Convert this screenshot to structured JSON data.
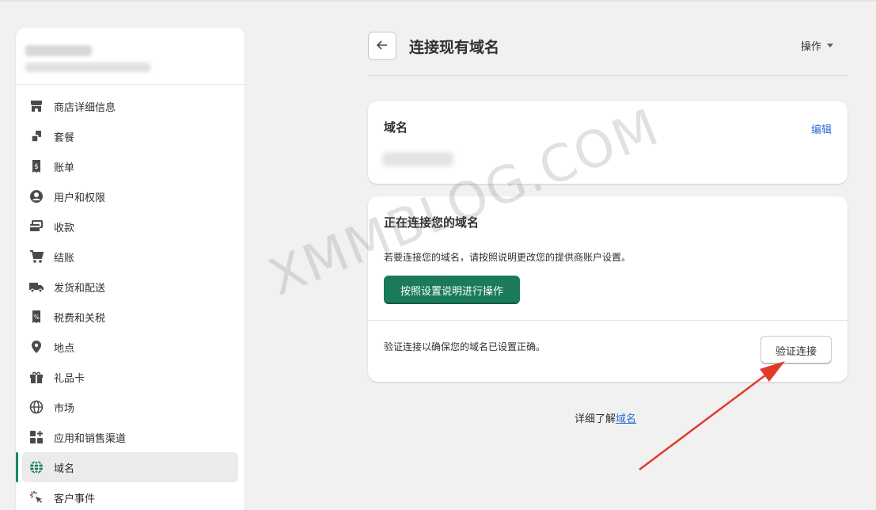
{
  "sidebar": {
    "items": [
      {
        "label": "商店详细信息",
        "icon": "store-icon"
      },
      {
        "label": "套餐",
        "icon": "plan-icon"
      },
      {
        "label": "账单",
        "icon": "billing-icon"
      },
      {
        "label": "用户和权限",
        "icon": "user-icon"
      },
      {
        "label": "收款",
        "icon": "payments-icon"
      },
      {
        "label": "结账",
        "icon": "cart-icon"
      },
      {
        "label": "发货和配送",
        "icon": "truck-icon"
      },
      {
        "label": "税费和关税",
        "icon": "tax-icon"
      },
      {
        "label": "地点",
        "icon": "location-icon"
      },
      {
        "label": "礼品卡",
        "icon": "gift-icon"
      },
      {
        "label": "市场",
        "icon": "globe-icon"
      },
      {
        "label": "应用和销售渠道",
        "icon": "apps-icon"
      },
      {
        "label": "域名",
        "icon": "domain-globe-icon",
        "active": true
      },
      {
        "label": "客户事件",
        "icon": "sparkle-icon"
      }
    ]
  },
  "header": {
    "title": "连接现有域名",
    "actions_label": "操作"
  },
  "domain_card": {
    "title": "域名",
    "edit_label": "编辑"
  },
  "connect_card": {
    "title": "正在连接您的域名",
    "description": "若要连接您的域名，请按照说明更改您的提供商账户设置。",
    "primary_button": "按照设置说明进行操作",
    "verify_text": "验证连接以确保您的域名已设置正确。",
    "verify_button": "验证连接"
  },
  "footer": {
    "prefix": "详细了解",
    "link": "域名"
  },
  "watermark": "XMMBLOG.COM",
  "colors": {
    "primary": "#1a7a5a",
    "active_indicator": "#1a8a5a",
    "link": "#2a6cd6",
    "arrow": "#e23a2a"
  }
}
